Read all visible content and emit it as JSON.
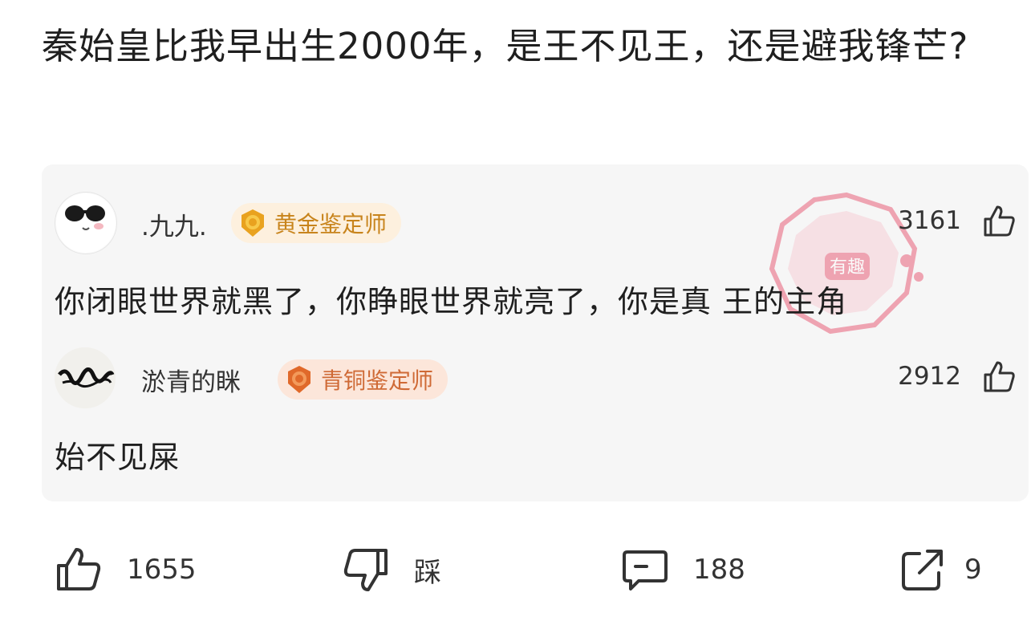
{
  "post": {
    "title": "秦始皇比我早出生2000年，是王不见王，还是避我锋芒?"
  },
  "comments": [
    {
      "user": ".九九.",
      "badge": "黄金鉴定师",
      "likes": "3161",
      "text": "你闭眼世界就黑了，你睁眼世界就亮了，你是真 王的主角"
    },
    {
      "user": "淤青的眯",
      "badge": "青铜鉴定师",
      "likes": "2912",
      "text": "始不见屎"
    }
  ],
  "watermark": {
    "text": "有趣"
  },
  "actions": {
    "like_count": "1655",
    "dislike_label": "踩",
    "comment_count": "188",
    "share_count": "9"
  },
  "colors": {
    "gold_badge": "#c8841c",
    "bronze_badge": "#cf6a36",
    "watermark": "#e8607a"
  }
}
